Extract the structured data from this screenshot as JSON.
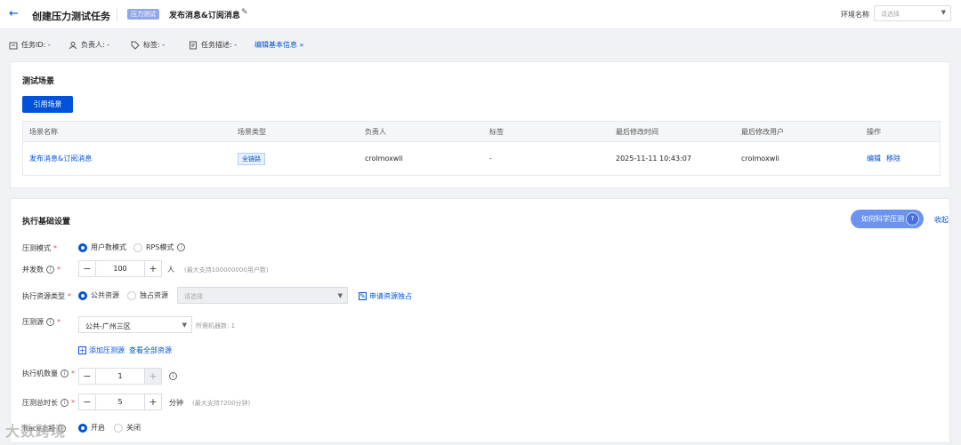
{
  "header": {
    "page_title": "创建压力测试任务",
    "type_tag": "压力测试",
    "task_name": "发布消息&订阅消息",
    "env_label": "环境名称",
    "env_placeholder": "请选择"
  },
  "infobar": {
    "task_id": "任务ID: -",
    "owner": "负责人: -",
    "tags": "标签: -",
    "description": "任务描述: -",
    "edit_basic": "编辑基本信息 »"
  },
  "scenario": {
    "title": "测试场景",
    "ref_button": "引用场景",
    "columns": [
      "场景名称",
      "场景类型",
      "负责人",
      "标签",
      "最后修改时间",
      "最后修改用户",
      "操作"
    ],
    "row": {
      "name": "发布消息&订阅消息",
      "type": "全链路",
      "owner": "crolmoxwli",
      "tags": "-",
      "modified_time": "2025-11-11 10:43:07",
      "modified_user": "crolmoxwli",
      "action_edit": "编辑",
      "action_remove": "移除"
    }
  },
  "settings": {
    "title": "执行基础设置",
    "guide_button": "如何科学压测",
    "collapse": "收起",
    "mode_label": "压测模式",
    "mode_user": "用户数模式",
    "mode_rps": "RPS模式",
    "concurrency_label": "并发数",
    "concurrency_value": "100",
    "concurrency_unit": "人",
    "concurrency_hint": "(最大支持100000000用户数)",
    "resource_type_label": "执行资源类型",
    "resource_public": "公共资源",
    "resource_exclusive": "独占资源",
    "resource_placeholder": "请选择",
    "apply_exclusive": "申请资源独占",
    "source_label": "压测源",
    "source_value": "公共-广州三区",
    "machines_hint": "所需机器数: 1",
    "add_source": "添加压测源",
    "view_all": "查看全部资源",
    "machine_count_label": "执行机数量",
    "machine_count_value": "1",
    "duration_label": "压测总时长",
    "duration_value": "5",
    "duration_unit": "分钟",
    "duration_hint": "(最大支持7200分钟)",
    "trace_label": "Trace上报",
    "trace_on": "开启",
    "trace_off": "关闭"
  },
  "watermark": "大数跨境",
  "colors": {
    "primary": "#0052d9",
    "required": "#e34d59"
  }
}
